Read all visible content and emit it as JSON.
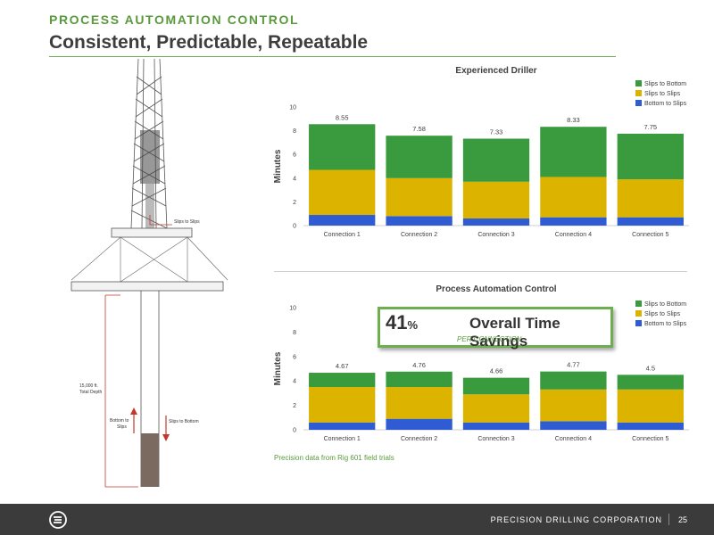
{
  "header": {
    "kicker": "PROCESS AUTOMATION CONTROL",
    "title": "Consistent, Predictable, Repeatable"
  },
  "rig_labels": {
    "slips_to_slips": "Slips to Slips",
    "depth_line1": "15,000 ft.",
    "depth_line2": "Total Depth",
    "bottom_to_slips_line1": "Bottom to",
    "bottom_to_slips_line2": "Slips",
    "slips_to_bottom": "Slips to Bottom"
  },
  "colors": {
    "slips_to_bottom": "#3a9a3e",
    "slips_to_slips": "#dcb400",
    "bottom_to_slips": "#2f5bd3",
    "accent_green": "#6fae4e",
    "red_arrow": "#c0392b"
  },
  "chart_data": [
    {
      "type": "bar",
      "stacked": true,
      "title": "Experienced Driller",
      "ylabel": "Minutes",
      "xlabel": "",
      "ylim": [
        0,
        10
      ],
      "yticks": [
        "0",
        "2",
        "4",
        "6",
        "8",
        "10"
      ],
      "categories": [
        "Connection 1",
        "Connection 2",
        "Connection 3",
        "Connection 4",
        "Connection 5"
      ],
      "totals_labels": [
        "8.55",
        "7.58",
        "7.33",
        "8.33",
        "7.75"
      ],
      "legend_position": "top-right",
      "series": [
        {
          "name": "Bottom to Slips",
          "values": [
            0.9,
            0.8,
            0.6,
            0.7,
            0.7
          ]
        },
        {
          "name": "Slips to Slips",
          "values": [
            3.8,
            3.2,
            3.1,
            3.4,
            3.2
          ]
        },
        {
          "name": "Slips to Bottom",
          "values": [
            3.85,
            3.58,
            3.63,
            4.23,
            3.85
          ]
        }
      ]
    },
    {
      "type": "bar",
      "stacked": true,
      "title": "Process Automation Control",
      "ylabel": "Minutes",
      "xlabel": "",
      "ylim": [
        0,
        10
      ],
      "yticks": [
        "0",
        "2",
        "4",
        "6",
        "8",
        "10"
      ],
      "categories": [
        "Connection 1",
        "Connection 2",
        "Connection 3",
        "Connection 4",
        "Connection 5"
      ],
      "totals_labels": [
        "4.67",
        "4.76",
        "4.66",
        "4.77",
        "4.5"
      ],
      "legend_position": "top-right",
      "series": [
        {
          "name": "Bottom to Slips",
          "values": [
            0.6,
            0.9,
            0.6,
            0.7,
            0.6
          ]
        },
        {
          "name": "Slips to Slips",
          "values": [
            2.9,
            2.6,
            2.3,
            2.6,
            2.7
          ]
        },
        {
          "name": "Slips to Bottom",
          "values": [
            1.17,
            1.26,
            1.36,
            1.47,
            1.2
          ]
        }
      ]
    }
  ],
  "savings": {
    "percent": "41",
    "percent_sign": "%",
    "label": "Overall Time Savings",
    "sub": "PER CONNECTION"
  },
  "footnote": "Precision data from Rig 601 field trials",
  "footer": {
    "brand": "PRECISION DRILLING CORPORATION",
    "page": "25"
  }
}
